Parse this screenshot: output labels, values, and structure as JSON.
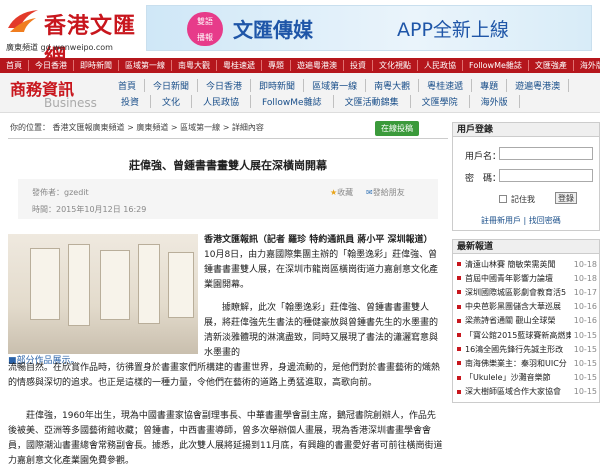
{
  "site": {
    "logo_cn": "香港文匯網",
    "logo_sub": "廣東頻道  gd.wenweipo.com"
  },
  "banner": {
    "badge": "雙語\n播報",
    "brand": "文匯傳媒",
    "slogan": "APP全新上線"
  },
  "topnav": [
    "首頁",
    "今日香港",
    "即時新聞",
    "區域第一線",
    "南粵大觀",
    "粵桂速遞",
    "專題",
    "遊遍粵港澳",
    "投資",
    "文化視點",
    "人民政協",
    "FollowMe雜誌",
    "文匯強產",
    "海外版"
  ],
  "subnav": {
    "title": "商務資訊",
    "title_en": "Business",
    "row1": [
      "首頁",
      "今日新聞",
      "今日香港",
      "即時新聞",
      "區域第一線",
      "南粵大觀",
      "粵桂速遞",
      "專題",
      "遊遍粵港澳"
    ],
    "row2": [
      "投資",
      "文化",
      "人民政協",
      "FollowMe雜誌",
      "文匯活動錦集",
      "文匯學院",
      "海外版"
    ]
  },
  "breadcrumb": {
    "prefix": "你的位置：",
    "items": [
      "香港文匯報廣東頻道",
      "廣東頻道",
      "區域第一線",
      "詳細內容"
    ]
  },
  "vote_btn": "在線投稿",
  "article": {
    "title": "莊偉強、曾鍾書書畫雙人展在深橫崗開幕",
    "poster": "發佈者：gzedit",
    "time": "時間：2015年10月12日 16:29",
    "fav": "收藏",
    "send": "發給朋友",
    "caption": "■部分作品展示。",
    "p1_lead": "香港文匯報訊（記者 羅珍 特約通訊員 蔣小平 深圳報道）",
    "p1_rest": "10月8日，由力嘉國際集團主辦的「翰墨逸彩」莊偉強、曾鍾書書畫雙人展，在深圳市龍崗區橫崗街道力嘉創意文化產業園開幕。",
    "p2": "據瞭解，此次「翰墨逸彩」莊偉強、曾鍾書書畫雙人展，將莊偉強先生書法的種健豪放與曾鍾書先生的水墨畫的清新淡雅體現的淋漓盡致，同時又展現了書法的瀟灑寫意與水墨畫的",
    "p2_cont": "流暢自然。在欣賞作品時，彷彿置身於書畫家們所構建的書畫世界，身邊流動的，是他們對於書畫藝術的熾熱的情感與深切的追求。也正是這樣的一種力量，令他們在藝術的道路上勇猛進取，高歌向前。",
    "p3": "莊偉強，1960年出生，現為中國書畫家協會副理事長、中華書畫學會副主席，鵝冠書院創辦人，作品先後被美、亞洲等多國藝術館收藏；曾鍾書，中西書畫導師，曾多次舉辦個人畫展，現為香港深圳書畫學會會員，國際潮汕書畫總會常務副會長。據悉，此次雙人展將延揚到11月底，有興趣的書畫愛好者可前往橫崗街道力嘉創意文化產業園免費參觀。"
  },
  "login": {
    "title": "用戶登錄",
    "user_label": "用戶名：",
    "pass_label": "密　碼：",
    "remember": "記住我",
    "submit": "登錄",
    "links": "註冊新用戶 | 找回密碼"
  },
  "latest": {
    "title": "最新報道",
    "items": [
      {
        "t": "清遠山林賽 簡敏荣需英聞",
        "d": "10-18"
      },
      {
        "t": "首屆中國青年影響力論壇",
        "d": "10-18"
      },
      {
        "t": "深圳國際城區影劇會教育活5",
        "d": "10-17"
      },
      {
        "t": "中央芭影黑團儲含大華巡展",
        "d": "10-16"
      },
      {
        "t": "梁燕詩省通關 觀山全球榮",
        "d": "10-16"
      },
      {
        "t": "「寶公館2015藍球賽新高燃東",
        "d": "10-15"
      },
      {
        "t": "16鴻全國先鋒行先誠主形改",
        "d": "10-15"
      },
      {
        "t": "南海佛樂業主：秦羽和UIC分",
        "d": "10-15"
      },
      {
        "t": "「Ukulele」沙灘音樂節",
        "d": "10-15"
      },
      {
        "t": "深大樹師區域合作大家協會",
        "d": "10-15"
      }
    ]
  }
}
